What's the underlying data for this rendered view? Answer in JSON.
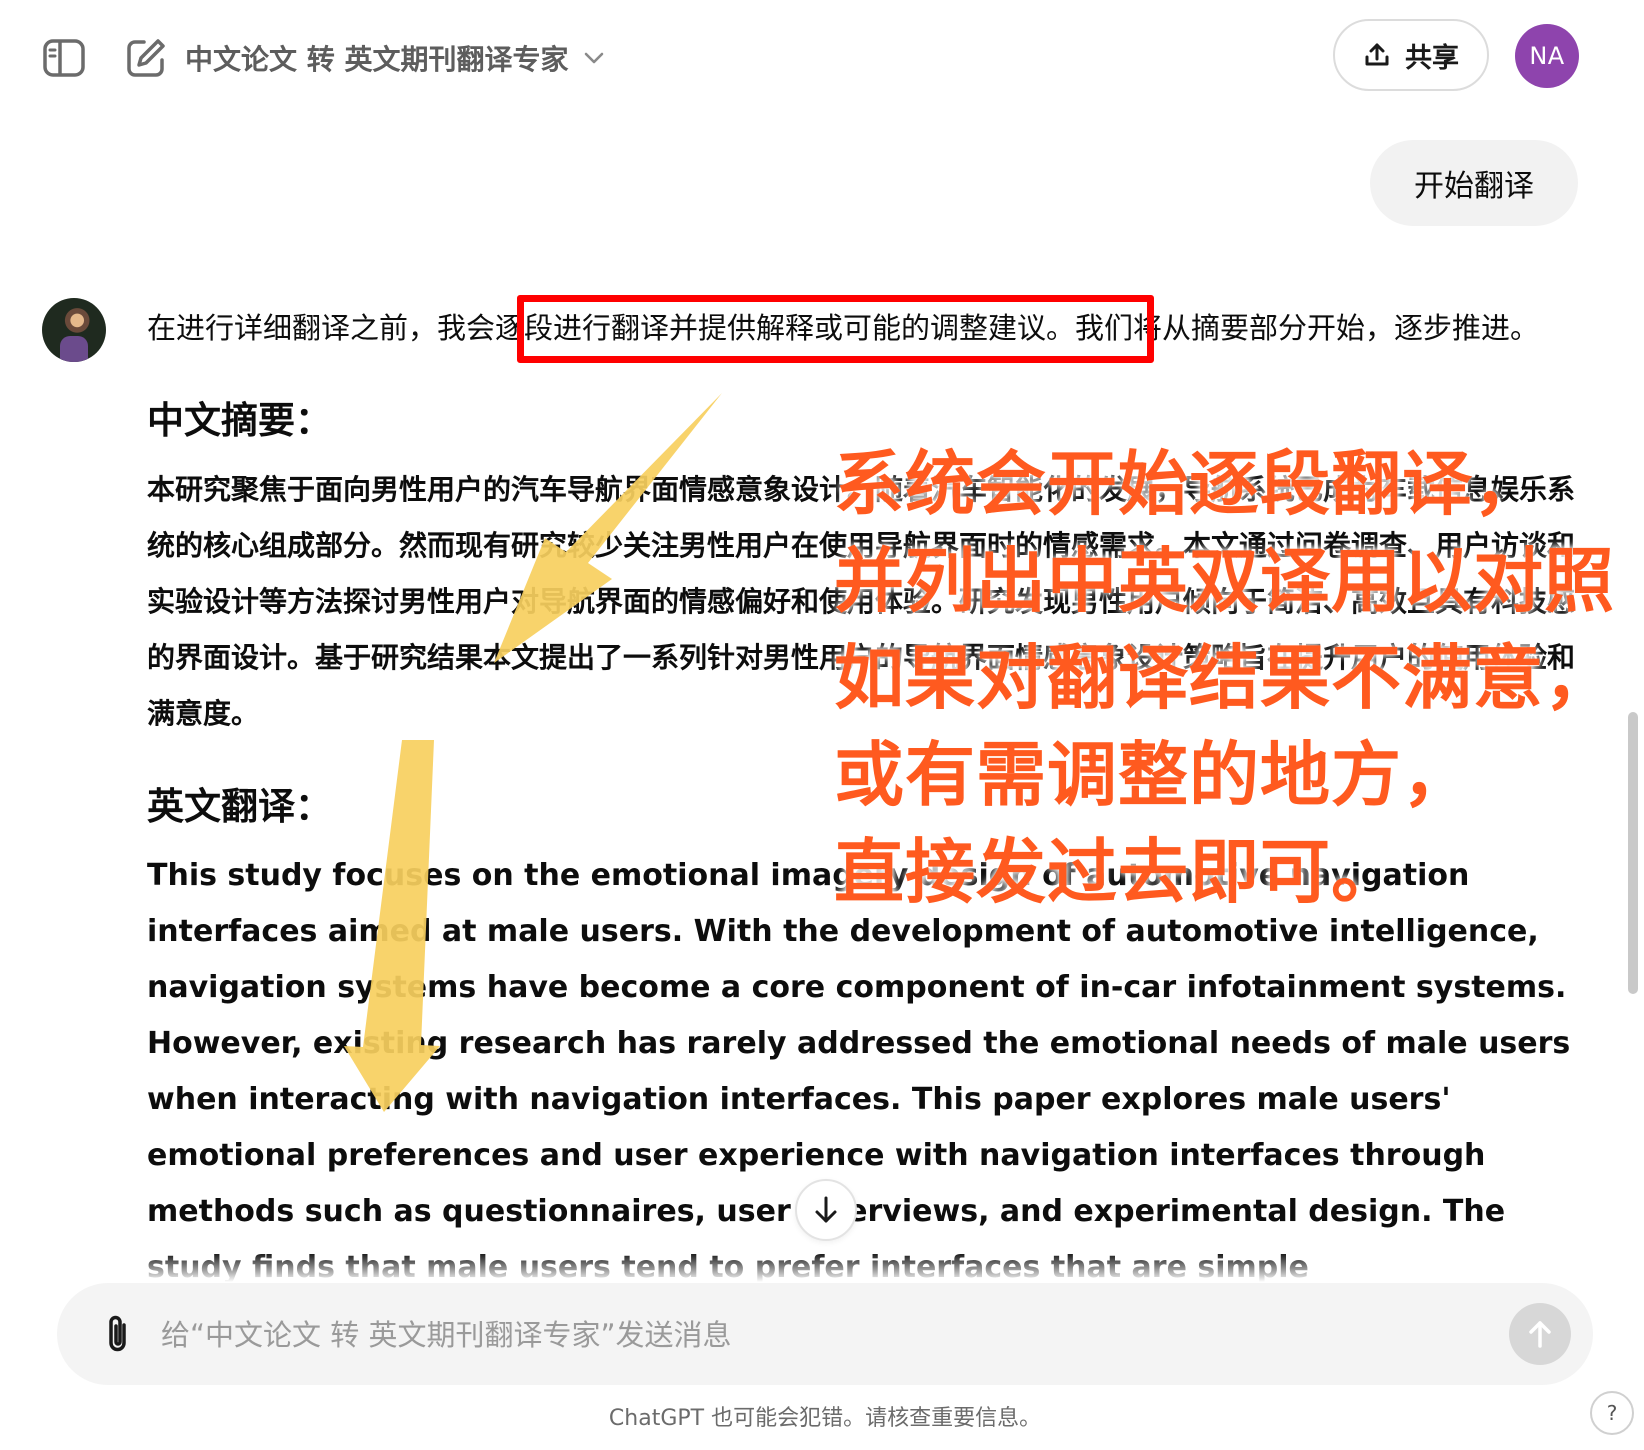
{
  "header": {
    "gpt_title": "中文论文 转 英文期刊翻译专家",
    "share_label": "共享",
    "avatar_initials": "NA",
    "avatar_color": "#8e44ad"
  },
  "user_message": "开始翻译",
  "assistant": {
    "intro_before": "在进行详细翻译之前，我会",
    "intro_highlight": "逐段进行翻译并提供解释或可能的调整建议。",
    "intro_after": "我们将从摘要部分开始，逐步推进。",
    "zh_heading": "中文摘要：",
    "zh_paragraph": "本研究聚焦于面向男性用户的汽车导航界面情感意象设计。随着汽车智能化的发展，导航系统已成为车载信息娱乐系统的核心组成部分。然而现有研究较少关注男性用户在使用导航界面时的情感需求。本文通过问卷调查、用户访谈和实验设计等方法探讨男性用户对导航界面的情感偏好和使用体验。研究发现男性用户倾向于简洁、高效且具有科技感的界面设计。基于研究结果本文提出了一系列针对男性用户的导航界面情感意象设计策略旨在提升用户的使用体验和满意度。",
    "en_heading": "英文翻译：",
    "en_paragraph": "This study focuses on the emotional imagery design of automotive navigation interfaces aimed at male users. With the development of automotive intelligence, navigation systems have become a core component of in-car infotainment systems. However, existing research has rarely addressed the emotional needs of male users when interacting with navigation interfaces. This paper explores male users' emotional preferences and user experience with navigation interfaces through methods such as questionnaires, user interviews, and experimental design. The study finds that male users tend to prefer interfaces that are simple"
  },
  "annotation": {
    "lines": [
      "系统会开始逐段翻译，",
      "并列出中英双译用以对照",
      "如果对翻译结果不满意，",
      "或有需调整的地方，",
      "直接发过去即可。"
    ],
    "text_color": "#ff5a1f",
    "box_color": "#ff0000",
    "arrow_color": "#f7cf5e"
  },
  "composer": {
    "placeholder": "给“中文论文 转 英文期刊翻译专家”发送消息"
  },
  "footer": {
    "disclaimer": "ChatGPT 也可能会犯错。请核查重要信息。",
    "help_label": "?"
  }
}
